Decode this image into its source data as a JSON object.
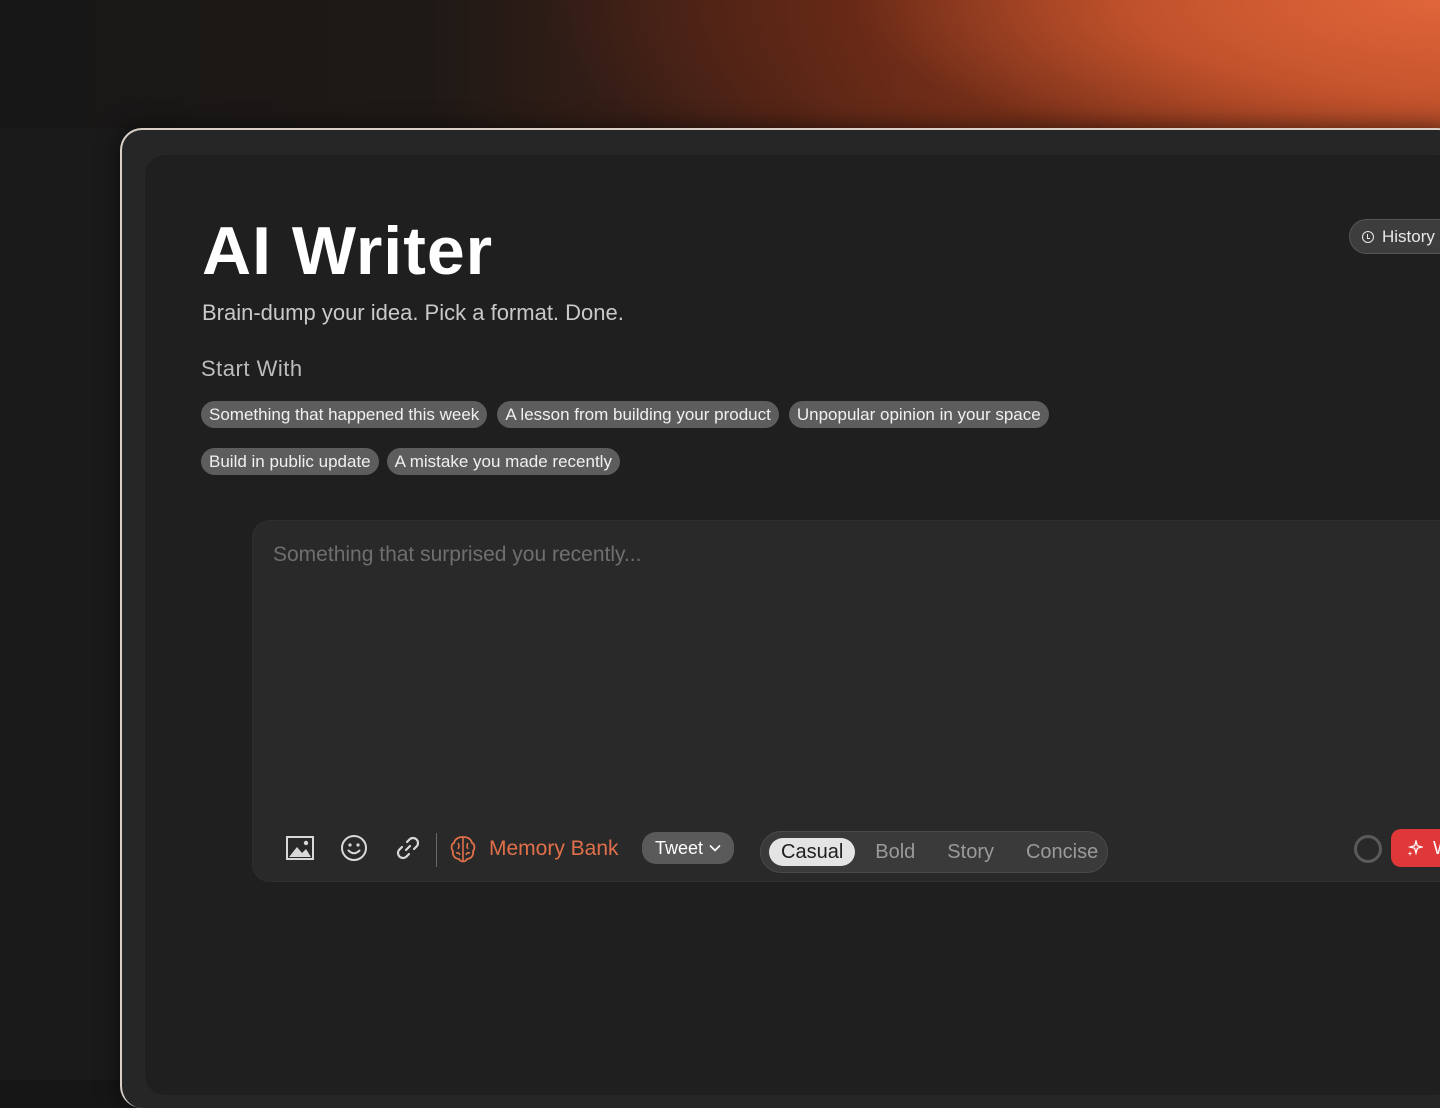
{
  "app": {
    "title": "AI Writer",
    "subtitle": "Brain-dump your idea. Pick a format. Done.",
    "history_label": "History"
  },
  "start_with": {
    "label": "Start With",
    "prompts_row1": [
      "Something that happened this week",
      "A lesson from building your product",
      "Unpopular opinion in your space"
    ],
    "prompts_row2": [
      "Build in public update",
      "A mistake you made recently"
    ]
  },
  "editor": {
    "placeholder": "Something that surprised you recently...",
    "value": ""
  },
  "toolbar": {
    "memory_bank_label": "Memory Bank",
    "format_selected": "Tweet",
    "tones": [
      "Casual",
      "Bold",
      "Story",
      "Concise"
    ],
    "tone_selected": "Casual",
    "write_label": "W"
  },
  "colors": {
    "accent": "#e0704a",
    "write_button": "#e03838",
    "background": "#1f1f1f"
  },
  "icons": [
    "clock-icon",
    "image-icon",
    "emoji-icon",
    "link-icon",
    "brain-icon",
    "chevron-down-icon",
    "sparkle-icon"
  ]
}
